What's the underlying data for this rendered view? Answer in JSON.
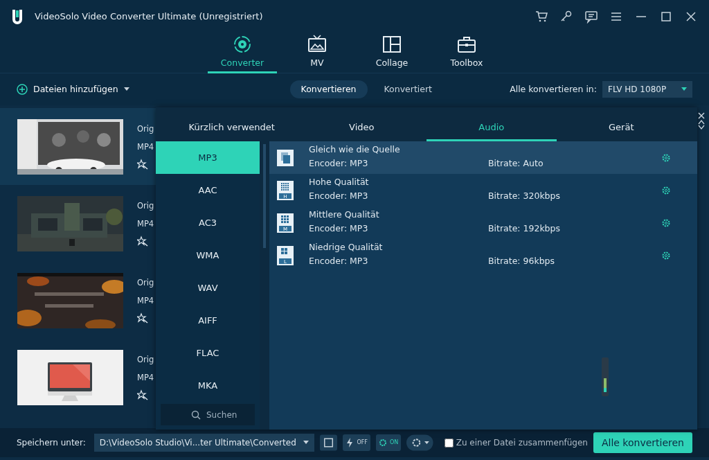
{
  "window": {
    "title": "VideoSolo Video Converter Ultimate (Unregistriert)"
  },
  "main_tabs": [
    {
      "label": "Converter",
      "kind": "converter",
      "selected": true
    },
    {
      "label": "MV",
      "kind": "mv",
      "selected": false
    },
    {
      "label": "Collage",
      "kind": "collage",
      "selected": false
    },
    {
      "label": "Toolbox",
      "kind": "toolbox",
      "selected": false
    }
  ],
  "toolbar": {
    "add_files": "Dateien hinzufügen",
    "view_tabs": [
      {
        "label": "Konvertieren",
        "selected": true
      },
      {
        "label": "Konvertiert",
        "selected": false
      }
    ],
    "convert_all_label": "Alle konvertieren in:",
    "convert_all_format": "FLV HD 1080P"
  },
  "files": [
    {
      "original": "Orig",
      "format": "MP4",
      "selected": true,
      "kind": "billboard"
    },
    {
      "original": "Orig",
      "format": "MP4",
      "selected": false,
      "kind": "house"
    },
    {
      "original": "Orig",
      "format": "MP4",
      "selected": false,
      "kind": "leaves"
    },
    {
      "original": "Orig",
      "format": "MP4",
      "selected": false,
      "kind": "monitor"
    }
  ],
  "format_panel": {
    "tabs": [
      {
        "label": "Kürzlich verwendet",
        "selected": false
      },
      {
        "label": "Video",
        "selected": false
      },
      {
        "label": "Audio",
        "selected": true
      },
      {
        "label": "Gerät",
        "selected": false
      }
    ],
    "formats": [
      {
        "label": "MP3",
        "selected": true
      },
      {
        "label": "AAC",
        "selected": false
      },
      {
        "label": "AC3",
        "selected": false
      },
      {
        "label": "WMA",
        "selected": false
      },
      {
        "label": "WAV",
        "selected": false
      },
      {
        "label": "AIFF",
        "selected": false
      },
      {
        "label": "FLAC",
        "selected": false
      },
      {
        "label": "MKA",
        "selected": false
      }
    ],
    "search": {
      "placeholder": "Suchen"
    },
    "presets": [
      {
        "kind": "same",
        "name": "Gleich wie die Quelle",
        "encoder": "Encoder: MP3",
        "bitrate": "Bitrate: Auto",
        "selected": true
      },
      {
        "kind": "high",
        "badge": "H",
        "name": "Hohe Qualität",
        "encoder": "Encoder: MP3",
        "bitrate": "Bitrate: 320kbps",
        "selected": false
      },
      {
        "kind": "medium",
        "badge": "M",
        "name": "Mittlere Qualität",
        "encoder": "Encoder: MP3",
        "bitrate": "Bitrate: 192kbps",
        "selected": false
      },
      {
        "kind": "low",
        "badge": "L",
        "name": "Niedrige Qualität",
        "encoder": "Encoder: MP3",
        "bitrate": "Bitrate: 96kbps",
        "selected": false
      }
    ]
  },
  "bottom_bar": {
    "save_label": "Speichern unter:",
    "save_path": "D:\\VideoSolo Studio\\Vi...ter Ultimate\\Converted",
    "toggles": [
      {
        "label": "OFF",
        "on": false
      },
      {
        "label": "ON",
        "on": true
      }
    ],
    "merge": {
      "label": "Zu einer Datei zusammenfügen",
      "checked": false
    },
    "convert_button": "Alle konvertieren"
  }
}
